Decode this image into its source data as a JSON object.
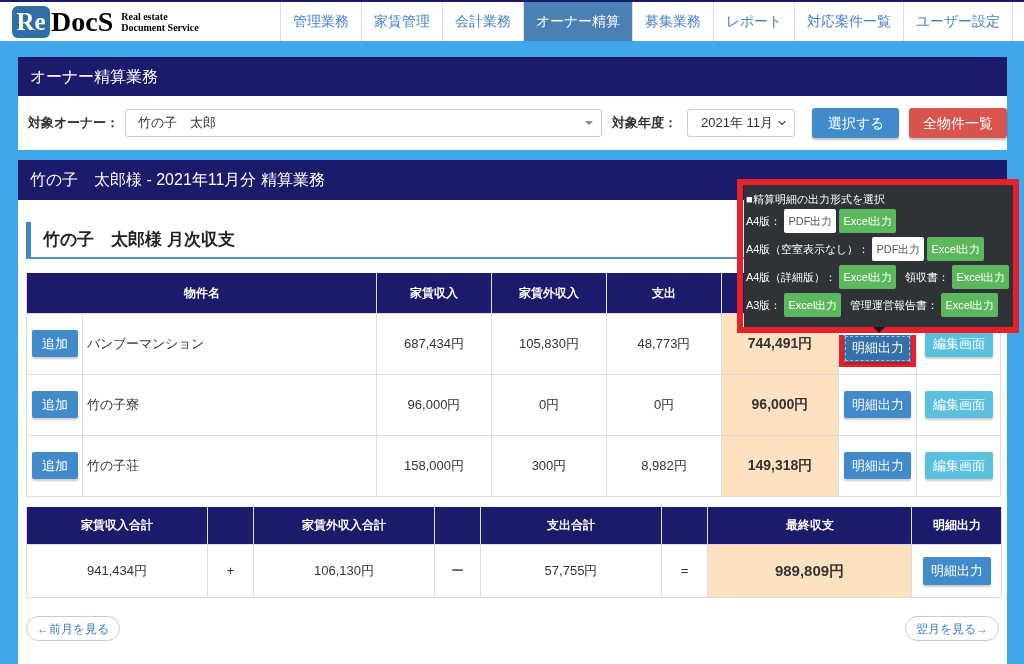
{
  "header": {
    "logo": {
      "mark": "Re",
      "name": "DocS",
      "tagline": [
        "Real estate",
        "Document Service"
      ]
    },
    "nav": [
      {
        "label": "管理業務",
        "selected": false
      },
      {
        "label": "家賃管理",
        "selected": false
      },
      {
        "label": "会計業務",
        "selected": false
      },
      {
        "label": "オーナー精算",
        "selected": true
      },
      {
        "label": "募集業務",
        "selected": false
      },
      {
        "label": "レポート",
        "selected": false
      },
      {
        "label": "対応案件一覧",
        "selected": false
      },
      {
        "label": "ユーザー設定",
        "selected": false
      }
    ]
  },
  "owner_panel": {
    "title": "オーナー精算業務",
    "owner_field": {
      "label": "対象オーナー：",
      "value": "竹の子　太郎"
    },
    "period_field": {
      "label": "対象年度：",
      "value": "2021年 11月"
    },
    "buttons": [
      {
        "label": "選択する",
        "kind": "primary"
      },
      {
        "label": "全物件一覧",
        "kind": "danger"
      }
    ]
  },
  "settlement_panel": {
    "title": "竹の子　太郎様 - 2021年11月分 精算業務",
    "section_title": "竹の子　太郎様 月次収支",
    "table": {
      "columns": [
        "物件名",
        "家賃収入",
        "家賃外収入",
        "支出"
      ],
      "rows": [
        {
          "add_button": "追加",
          "name": "バンブーマンション",
          "rent_income": "687,434円",
          "other_income": "105,830円",
          "expense": "48,773円",
          "balance": "744,491円",
          "detail_button": "明細出力",
          "edit_button": "編集画面",
          "detail_highlighted": true
        },
        {
          "add_button": "追加",
          "name": "竹の子寮",
          "rent_income": "96,000円",
          "other_income": "0円",
          "expense": "0円",
          "balance": "96,000円",
          "detail_button": "明細出力",
          "edit_button": "編集画面",
          "detail_highlighted": false
        },
        {
          "add_button": "追加",
          "name": "竹の子荘",
          "rent_income": "158,000円",
          "other_income": "300円",
          "expense": "8,982円",
          "balance": "149,318円",
          "detail_button": "明細出力",
          "edit_button": "編集画面",
          "detail_highlighted": false
        }
      ]
    },
    "summary": {
      "cells": [
        {
          "kind": "amount",
          "heading": "家賃収入合計",
          "value": "941,434円"
        },
        {
          "kind": "operator",
          "value": "+"
        },
        {
          "kind": "amount",
          "heading": "家賃外収入合計",
          "value": "106,130円"
        },
        {
          "kind": "operator",
          "value": "ー"
        },
        {
          "kind": "amount",
          "heading": "支出合計",
          "value": "57,755円"
        },
        {
          "kind": "operator",
          "value": "="
        },
        {
          "kind": "total",
          "heading": "最終収支",
          "value": "989,809円"
        },
        {
          "kind": "action",
          "heading": "明細出力",
          "value": "明細出力"
        }
      ]
    },
    "prev_button": "←前月を見る",
    "next_button": "翌月を見る→"
  },
  "popover": {
    "title": "■精算明細の出力形式を選択",
    "highlighted": true,
    "rows": [
      {
        "items": [
          {
            "kind": "label",
            "text": "A4版："
          },
          {
            "kind": "pdf",
            "text": "PDF出力"
          },
          {
            "kind": "excel",
            "text": "Excel出力"
          }
        ]
      },
      {
        "items": [
          {
            "kind": "label",
            "text": "A4版（空室表示なし）："
          },
          {
            "kind": "pdf",
            "text": "PDF出力"
          },
          {
            "kind": "excel",
            "text": "Excel出力"
          }
        ]
      },
      {
        "items": [
          {
            "kind": "label",
            "text": "A4版（詳細版）："
          },
          {
            "kind": "excel",
            "text": "Excel出力"
          },
          {
            "kind": "label",
            "text": "領収書："
          },
          {
            "kind": "excel",
            "text": "Excel出力"
          }
        ]
      },
      {
        "items": [
          {
            "kind": "label",
            "text": "A3版："
          },
          {
            "kind": "excel",
            "text": "Excel出力"
          },
          {
            "kind": "label",
            "text": "管理運営報告書："
          },
          {
            "kind": "excel",
            "text": "Excel出力"
          }
        ]
      }
    ]
  }
}
